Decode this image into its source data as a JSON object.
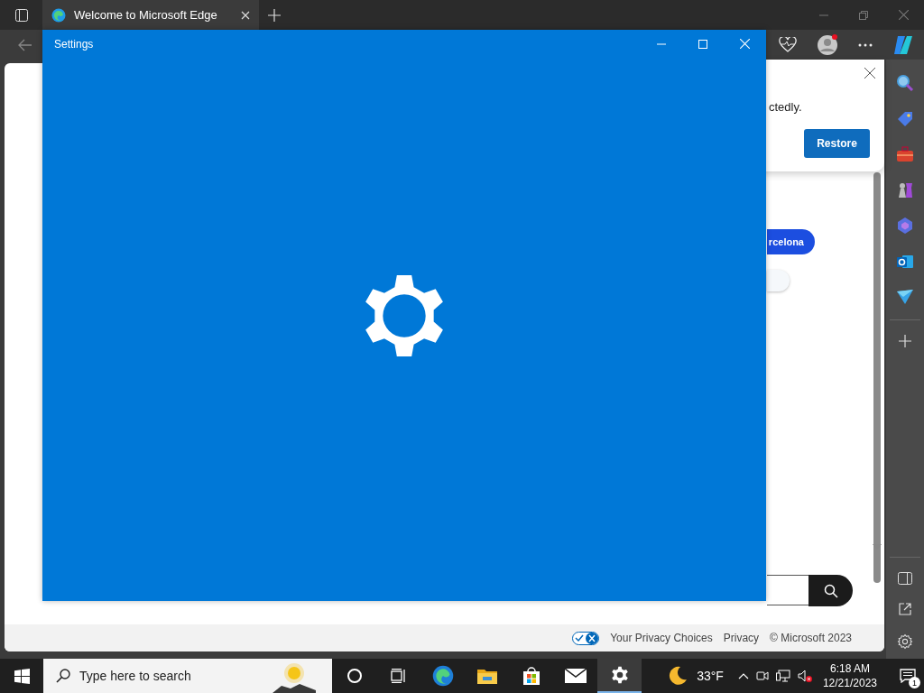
{
  "browser": {
    "tabs": [
      {
        "title": "Welcome to Microsoft Edge",
        "selected": true
      }
    ]
  },
  "settings_window": {
    "title": "Settings"
  },
  "notification": {
    "message": "ctedly.",
    "button": "Restore"
  },
  "page": {
    "chip": "rcelona",
    "footer": [
      "Your Privacy Choices",
      "Privacy",
      "© Microsoft 2023"
    ]
  },
  "taskbar": {
    "search": {
      "placeholder": "Type here to search"
    },
    "weather": "33°F",
    "time": "6:18 AM",
    "date": "12/21/2023",
    "notifications": "1",
    "apps": [
      {
        "kind": "cortana",
        "selected": false
      },
      {
        "kind": "taskview",
        "selected": false
      },
      {
        "kind": "edge",
        "selected": false
      },
      {
        "kind": "explorer",
        "selected": false
      },
      {
        "kind": "store",
        "selected": false
      },
      {
        "kind": "mail",
        "selected": false
      },
      {
        "kind": "settings",
        "selected": true
      }
    ]
  }
}
